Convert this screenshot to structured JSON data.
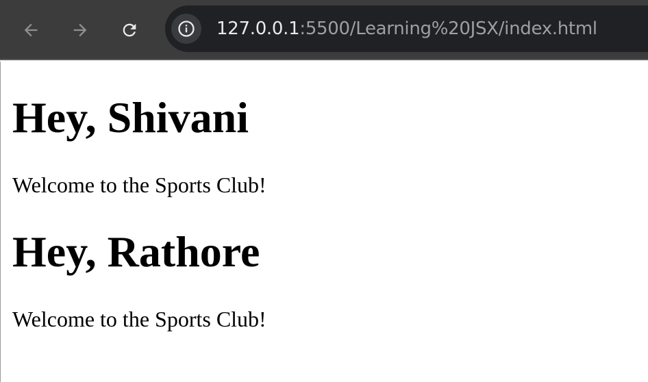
{
  "browser": {
    "url_host": "127.0.0.1",
    "url_rest": ":5500/Learning%20JSX/index.html"
  },
  "page": {
    "cards": [
      {
        "greeting": "Hey, Shivani",
        "message": "Welcome to the Sports Club!"
      },
      {
        "greeting": "Hey, Rathore",
        "message": "Welcome to the Sports Club!"
      }
    ]
  },
  "icons": {
    "back": "arrow-left-icon",
    "forward": "arrow-right-icon",
    "reload": "reload-icon",
    "site_info": "info-icon"
  }
}
